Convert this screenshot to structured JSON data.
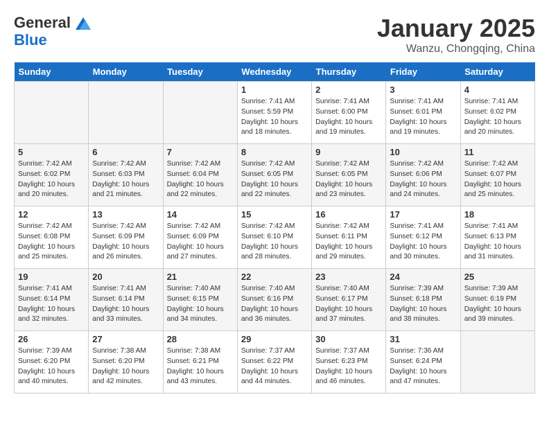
{
  "logo": {
    "line1": "General",
    "line2": "Blue"
  },
  "title": "January 2025",
  "location": "Wanzu, Chongqing, China",
  "weekdays": [
    "Sunday",
    "Monday",
    "Tuesday",
    "Wednesday",
    "Thursday",
    "Friday",
    "Saturday"
  ],
  "weeks": [
    [
      {
        "day": "",
        "sunrise": "",
        "sunset": "",
        "daylight": ""
      },
      {
        "day": "",
        "sunrise": "",
        "sunset": "",
        "daylight": ""
      },
      {
        "day": "",
        "sunrise": "",
        "sunset": "",
        "daylight": ""
      },
      {
        "day": "1",
        "sunrise": "Sunrise: 7:41 AM",
        "sunset": "Sunset: 5:59 PM",
        "daylight": "Daylight: 10 hours and 18 minutes."
      },
      {
        "day": "2",
        "sunrise": "Sunrise: 7:41 AM",
        "sunset": "Sunset: 6:00 PM",
        "daylight": "Daylight: 10 hours and 19 minutes."
      },
      {
        "day": "3",
        "sunrise": "Sunrise: 7:41 AM",
        "sunset": "Sunset: 6:01 PM",
        "daylight": "Daylight: 10 hours and 19 minutes."
      },
      {
        "day": "4",
        "sunrise": "Sunrise: 7:41 AM",
        "sunset": "Sunset: 6:02 PM",
        "daylight": "Daylight: 10 hours and 20 minutes."
      }
    ],
    [
      {
        "day": "5",
        "sunrise": "Sunrise: 7:42 AM",
        "sunset": "Sunset: 6:02 PM",
        "daylight": "Daylight: 10 hours and 20 minutes."
      },
      {
        "day": "6",
        "sunrise": "Sunrise: 7:42 AM",
        "sunset": "Sunset: 6:03 PM",
        "daylight": "Daylight: 10 hours and 21 minutes."
      },
      {
        "day": "7",
        "sunrise": "Sunrise: 7:42 AM",
        "sunset": "Sunset: 6:04 PM",
        "daylight": "Daylight: 10 hours and 22 minutes."
      },
      {
        "day": "8",
        "sunrise": "Sunrise: 7:42 AM",
        "sunset": "Sunset: 6:05 PM",
        "daylight": "Daylight: 10 hours and 22 minutes."
      },
      {
        "day": "9",
        "sunrise": "Sunrise: 7:42 AM",
        "sunset": "Sunset: 6:05 PM",
        "daylight": "Daylight: 10 hours and 23 minutes."
      },
      {
        "day": "10",
        "sunrise": "Sunrise: 7:42 AM",
        "sunset": "Sunset: 6:06 PM",
        "daylight": "Daylight: 10 hours and 24 minutes."
      },
      {
        "day": "11",
        "sunrise": "Sunrise: 7:42 AM",
        "sunset": "Sunset: 6:07 PM",
        "daylight": "Daylight: 10 hours and 25 minutes."
      }
    ],
    [
      {
        "day": "12",
        "sunrise": "Sunrise: 7:42 AM",
        "sunset": "Sunset: 6:08 PM",
        "daylight": "Daylight: 10 hours and 25 minutes."
      },
      {
        "day": "13",
        "sunrise": "Sunrise: 7:42 AM",
        "sunset": "Sunset: 6:09 PM",
        "daylight": "Daylight: 10 hours and 26 minutes."
      },
      {
        "day": "14",
        "sunrise": "Sunrise: 7:42 AM",
        "sunset": "Sunset: 6:09 PM",
        "daylight": "Daylight: 10 hours and 27 minutes."
      },
      {
        "day": "15",
        "sunrise": "Sunrise: 7:42 AM",
        "sunset": "Sunset: 6:10 PM",
        "daylight": "Daylight: 10 hours and 28 minutes."
      },
      {
        "day": "16",
        "sunrise": "Sunrise: 7:42 AM",
        "sunset": "Sunset: 6:11 PM",
        "daylight": "Daylight: 10 hours and 29 minutes."
      },
      {
        "day": "17",
        "sunrise": "Sunrise: 7:41 AM",
        "sunset": "Sunset: 6:12 PM",
        "daylight": "Daylight: 10 hours and 30 minutes."
      },
      {
        "day": "18",
        "sunrise": "Sunrise: 7:41 AM",
        "sunset": "Sunset: 6:13 PM",
        "daylight": "Daylight: 10 hours and 31 minutes."
      }
    ],
    [
      {
        "day": "19",
        "sunrise": "Sunrise: 7:41 AM",
        "sunset": "Sunset: 6:14 PM",
        "daylight": "Daylight: 10 hours and 32 minutes."
      },
      {
        "day": "20",
        "sunrise": "Sunrise: 7:41 AM",
        "sunset": "Sunset: 6:14 PM",
        "daylight": "Daylight: 10 hours and 33 minutes."
      },
      {
        "day": "21",
        "sunrise": "Sunrise: 7:40 AM",
        "sunset": "Sunset: 6:15 PM",
        "daylight": "Daylight: 10 hours and 34 minutes."
      },
      {
        "day": "22",
        "sunrise": "Sunrise: 7:40 AM",
        "sunset": "Sunset: 6:16 PM",
        "daylight": "Daylight: 10 hours and 36 minutes."
      },
      {
        "day": "23",
        "sunrise": "Sunrise: 7:40 AM",
        "sunset": "Sunset: 6:17 PM",
        "daylight": "Daylight: 10 hours and 37 minutes."
      },
      {
        "day": "24",
        "sunrise": "Sunrise: 7:39 AM",
        "sunset": "Sunset: 6:18 PM",
        "daylight": "Daylight: 10 hours and 38 minutes."
      },
      {
        "day": "25",
        "sunrise": "Sunrise: 7:39 AM",
        "sunset": "Sunset: 6:19 PM",
        "daylight": "Daylight: 10 hours and 39 minutes."
      }
    ],
    [
      {
        "day": "26",
        "sunrise": "Sunrise: 7:39 AM",
        "sunset": "Sunset: 6:20 PM",
        "daylight": "Daylight: 10 hours and 40 minutes."
      },
      {
        "day": "27",
        "sunrise": "Sunrise: 7:38 AM",
        "sunset": "Sunset: 6:20 PM",
        "daylight": "Daylight: 10 hours and 42 minutes."
      },
      {
        "day": "28",
        "sunrise": "Sunrise: 7:38 AM",
        "sunset": "Sunset: 6:21 PM",
        "daylight": "Daylight: 10 hours and 43 minutes."
      },
      {
        "day": "29",
        "sunrise": "Sunrise: 7:37 AM",
        "sunset": "Sunset: 6:22 PM",
        "daylight": "Daylight: 10 hours and 44 minutes."
      },
      {
        "day": "30",
        "sunrise": "Sunrise: 7:37 AM",
        "sunset": "Sunset: 6:23 PM",
        "daylight": "Daylight: 10 hours and 46 minutes."
      },
      {
        "day": "31",
        "sunrise": "Sunrise: 7:36 AM",
        "sunset": "Sunset: 6:24 PM",
        "daylight": "Daylight: 10 hours and 47 minutes."
      },
      {
        "day": "",
        "sunrise": "",
        "sunset": "",
        "daylight": ""
      }
    ]
  ]
}
